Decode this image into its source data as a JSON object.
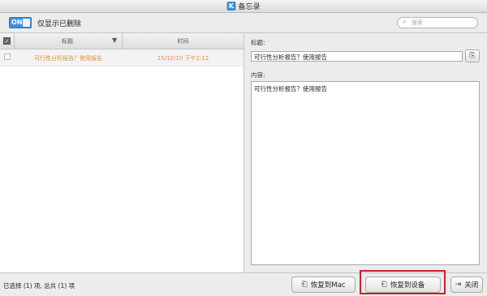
{
  "window": {
    "title": "备忘录",
    "app_icon_glyph": "K"
  },
  "toolbar": {
    "toggle_label": "ON",
    "filter_label": "仅显示已删除",
    "search_placeholder": "搜索"
  },
  "table": {
    "columns": [
      "标题",
      "时间"
    ],
    "sort_indicator": "▼",
    "rows": [
      {
        "title": "可行性分析报告？使用报告",
        "time": "15/12/10 下午2:12"
      }
    ]
  },
  "detail": {
    "title_label": "标题:",
    "title_value": "可行性分析报告？使用报告",
    "content_label": "内容:",
    "content_value": "可行性分析报告？使用报告"
  },
  "footer": {
    "status": "已选择 (1) 项, 总共 (1) 项",
    "restore_mac": "恢复到Mac",
    "restore_device": "恢复到设备",
    "close": "关闭"
  },
  "colors": {
    "accent": "#3d8ee0",
    "row_text": "#e0913f",
    "highlight": "#c8222a"
  }
}
